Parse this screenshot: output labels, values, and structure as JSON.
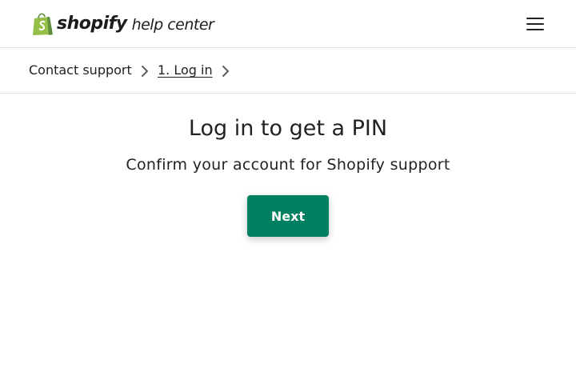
{
  "header": {
    "logo_brand": "shopify",
    "logo_tagline": "help center",
    "logo_icon": "shopify-bag-icon",
    "menu_icon": "hamburger-menu-icon"
  },
  "breadcrumb": {
    "items": [
      {
        "label": "Contact support"
      },
      {
        "label": "1. Log in"
      }
    ],
    "separator_icon": "chevron-right-icon"
  },
  "main": {
    "title": "Log in to get a PIN",
    "subtitle": "Confirm your account for Shopify support",
    "next_label": "Next"
  },
  "colors": {
    "brand_green": "#95bf47",
    "brand_green_dark": "#5e8e3e",
    "button": "#008060",
    "text": "#202223",
    "border": "#dfe3e8"
  }
}
